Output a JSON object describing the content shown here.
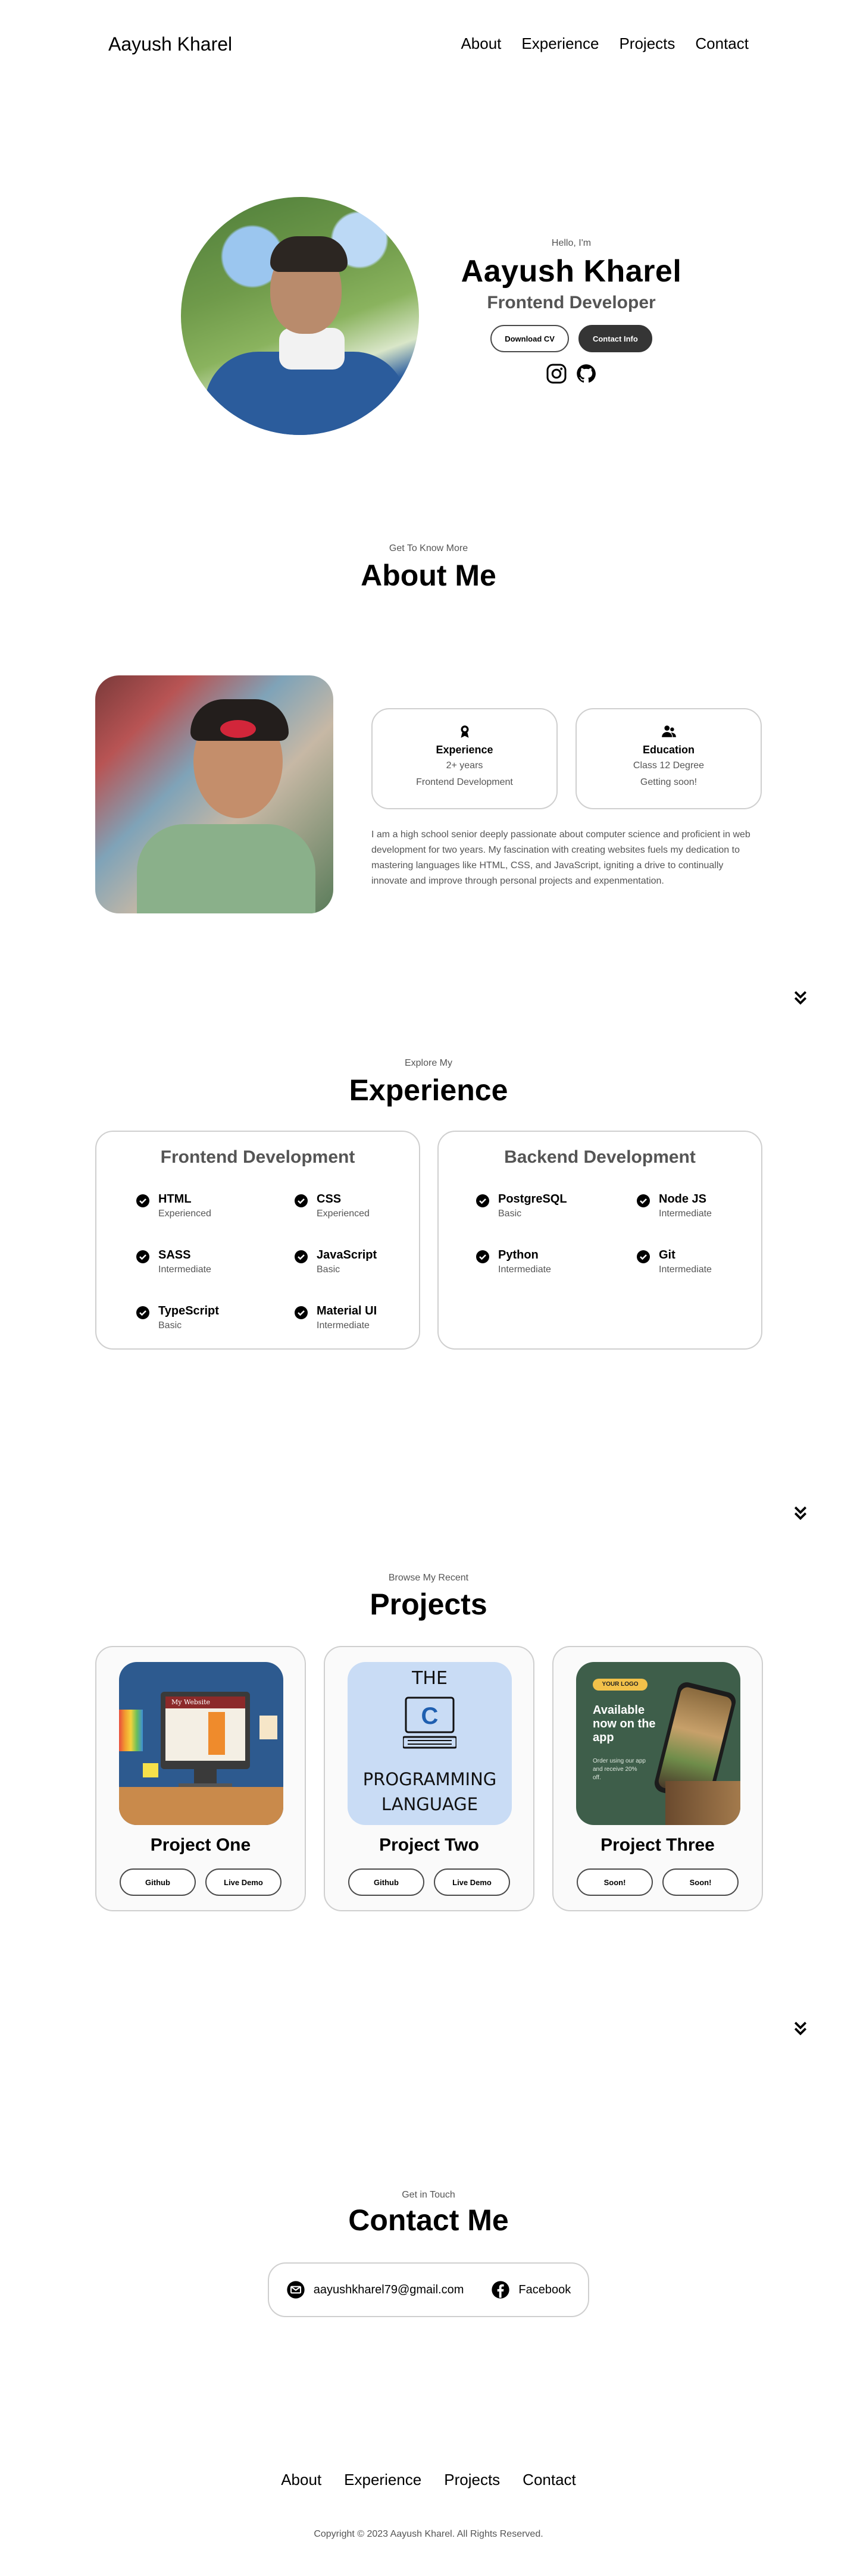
{
  "nav": {
    "logo": "Aayush Kharel",
    "links": [
      "About",
      "Experience",
      "Projects",
      "Contact"
    ]
  },
  "hero": {
    "greeting": "Hello, I'm",
    "name": "Aayush Kharel",
    "role": "Frontend Developer",
    "download_cv": "Download CV",
    "contact_info": "Contact Info"
  },
  "about": {
    "subtitle": "Get To Know More",
    "title": "About Me",
    "cards": [
      {
        "title": "Experience",
        "lines": [
          "2+ years",
          "Frontend Development"
        ]
      },
      {
        "title": "Education",
        "lines": [
          "Class 12 Degree",
          "Getting soon!"
        ]
      }
    ],
    "text": "I am a high school senior deeply passionate about computer science and proficient in web development for two years. My fascination with creating websites fuels my dedication to mastering languages like HTML, CSS, and JavaScript, igniting a drive to continually innovate and improve through personal projects and expenmentation."
  },
  "experience": {
    "subtitle": "Explore My",
    "title": "Experience",
    "frontend": {
      "title": "Frontend Development",
      "skills": [
        {
          "name": "HTML",
          "level": "Experienced"
        },
        {
          "name": "CSS",
          "level": "Experienced"
        },
        {
          "name": "SASS",
          "level": "Intermediate"
        },
        {
          "name": "JavaScript",
          "level": "Basic"
        },
        {
          "name": "TypeScript",
          "level": "Basic"
        },
        {
          "name": "Material UI",
          "level": "Intermediate"
        }
      ]
    },
    "backend": {
      "title": "Backend Development",
      "skills": [
        {
          "name": "PostgreSQL",
          "level": "Basic"
        },
        {
          "name": "Node JS",
          "level": "Intermediate"
        },
        {
          "name": "Python",
          "level": "Intermediate"
        },
        {
          "name": "Git",
          "level": "Intermediate"
        }
      ]
    }
  },
  "projects": {
    "subtitle": "Browse My Recent",
    "title": "Projects",
    "items": [
      {
        "title": "Project One",
        "btn1": "Github",
        "btn2": "Live Demo",
        "image_text": "My Website"
      },
      {
        "title": "Project Two",
        "btn1": "Github",
        "btn2": "Live Demo",
        "image_text_top": "THE",
        "image_text_bottom1": "PROGRAMMING",
        "image_text_bottom2": "LANGUAGE"
      },
      {
        "title": "Project Three",
        "btn1": "Soon!",
        "btn2": "Soon!",
        "image_logo": "YOUR LOGO",
        "image_headline": "Available now on the app",
        "image_body": "Order using our app and receive 20% off."
      }
    ]
  },
  "contact": {
    "subtitle": "Get in Touch",
    "title": "Contact Me",
    "email": "aayushkharel79@gmail.com",
    "facebook": "Facebook"
  },
  "footer": {
    "links": [
      "About",
      "Experience",
      "Projects",
      "Contact"
    ],
    "copyright": "Copyright © 2023 Aayush Kharel. All Rights Reserved."
  },
  "colors": {
    "dark_button": "#353535",
    "border": "#cfcfcf",
    "muted_text": "#555555"
  },
  "icons": [
    "instagram-icon",
    "github-icon",
    "experience-medal-icon",
    "education-group-icon",
    "check-icon",
    "arrow-down-icon",
    "email-icon",
    "facebook-icon"
  ]
}
